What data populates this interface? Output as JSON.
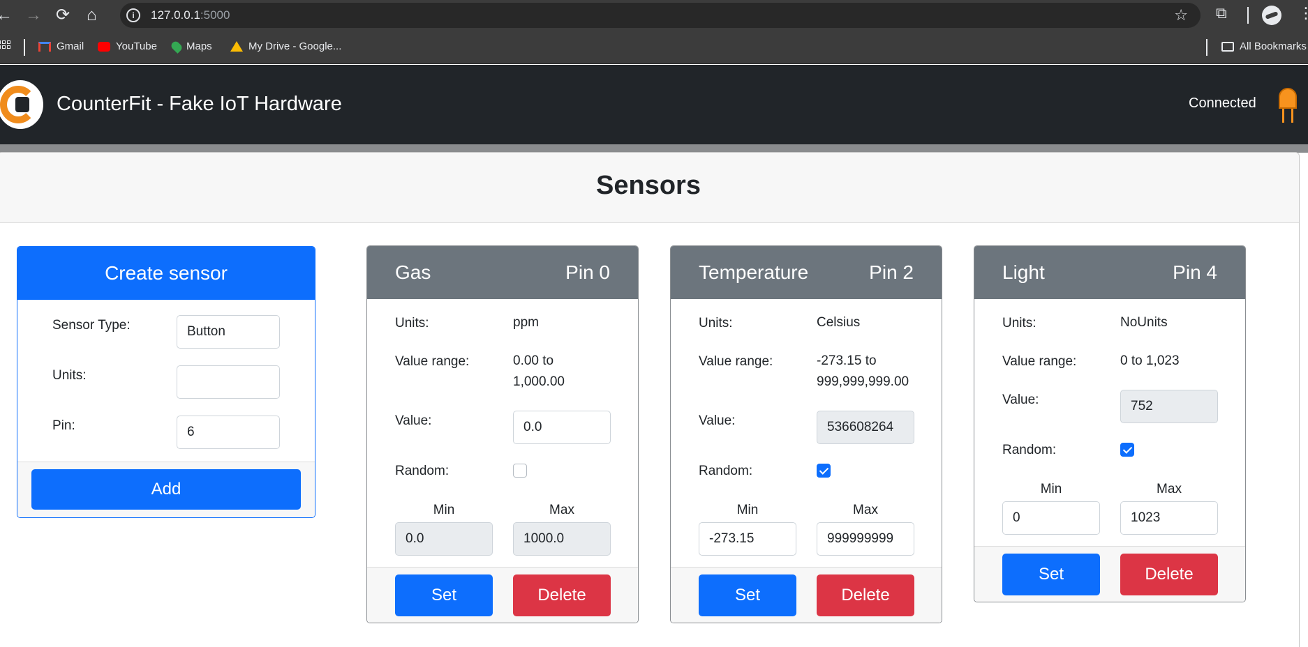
{
  "browser": {
    "url_host": "127.0.0.1",
    "url_port": ":5000",
    "bookmarks": [
      "Gmail",
      "YouTube",
      "Maps",
      "My Drive - Google..."
    ],
    "all_bookmarks": "All Bookmarks"
  },
  "app": {
    "title": "CounterFit - Fake IoT Hardware",
    "status": "Connected"
  },
  "page": {
    "heading": "Sensors"
  },
  "create": {
    "title": "Create sensor",
    "type_label": "Sensor Type:",
    "type_value": "Button",
    "units_label": "Units:",
    "units_value": "",
    "pin_label": "Pin:",
    "pin_value": "6",
    "add_label": "Add"
  },
  "labels": {
    "units": "Units:",
    "range": "Value range:",
    "value": "Value:",
    "random": "Random:",
    "min": "Min",
    "max": "Max",
    "set": "Set",
    "delete": "Delete"
  },
  "sensors": [
    {
      "name": "Gas",
      "pin": "Pin 0",
      "units": "ppm",
      "range_1": "0.00 to",
      "range_2": "1,000.00",
      "value": "0.0",
      "random": false,
      "min": "0.0",
      "max": "1000.0"
    },
    {
      "name": "Temperature",
      "pin": "Pin 2",
      "units": "Celsius",
      "range_1": "-273.15 to",
      "range_2": "999,999,999.00",
      "value": "536608264",
      "random": true,
      "min": "-273.15",
      "max": "999999999"
    },
    {
      "name": "Light",
      "pin": "Pin 4",
      "units": "NoUnits",
      "range_1": "0 to 1,023",
      "value": "752",
      "random": true,
      "min": "0",
      "max": "1023"
    }
  ]
}
